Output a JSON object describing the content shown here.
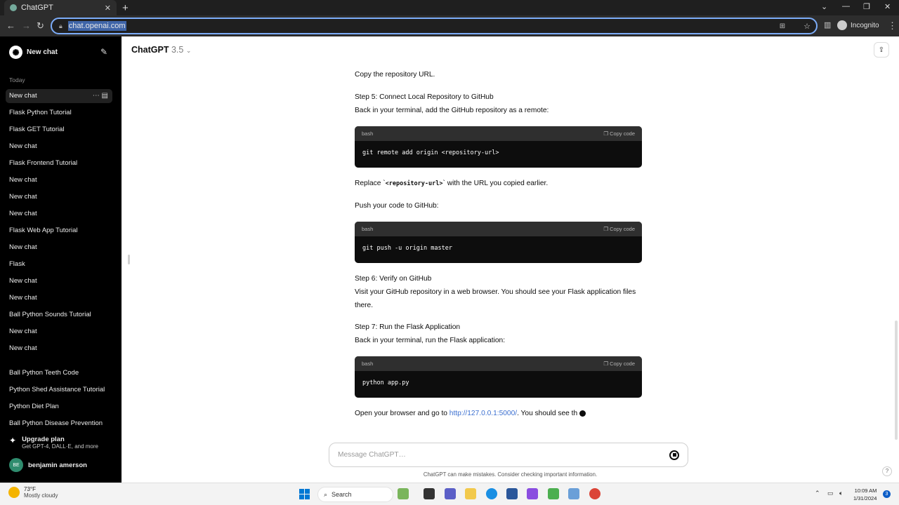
{
  "browser": {
    "tab_title": "ChatGPT",
    "url": "chat.openai.com",
    "incognito_label": "Incognito"
  },
  "sidebar": {
    "new_chat": "New chat",
    "section_today": "Today",
    "items": [
      {
        "label": "New chat",
        "active": true
      },
      {
        "label": "Flask Python Tutorial"
      },
      {
        "label": "Flask GET Tutorial"
      },
      {
        "label": "New chat"
      },
      {
        "label": "Flask Frontend Tutorial"
      },
      {
        "label": "New chat"
      },
      {
        "label": "New chat"
      },
      {
        "label": "New chat"
      },
      {
        "label": "Flask Web App Tutorial"
      },
      {
        "label": "New chat"
      },
      {
        "label": "Flask"
      },
      {
        "label": "New chat"
      },
      {
        "label": "New chat"
      },
      {
        "label": "Ball Python Sounds Tutorial"
      },
      {
        "label": "New chat"
      },
      {
        "label": "New chat"
      }
    ],
    "items2": [
      {
        "label": "Ball Python Teeth Code"
      },
      {
        "label": "Python Shed Assistance Tutorial"
      },
      {
        "label": "Python Diet Plan"
      },
      {
        "label": "Ball Python Disease Prevention"
      }
    ],
    "upgrade_title": "Upgrade plan",
    "upgrade_sub": "Get GPT-4, DALL·E, and more",
    "user_initials": "BE",
    "user_name": "benjamin amerson"
  },
  "header": {
    "model": "ChatGPT",
    "version": "3.5"
  },
  "content": {
    "p1": "Copy the repository URL.",
    "step5_title": "Step 5: Connect Local Repository to GitHub",
    "step5_text": "Back in your terminal, add the GitHub repository as a remote:",
    "code1_lang": "bash",
    "code1": "git remote add origin <repository-url>",
    "replace_pre": "Replace `",
    "replace_code": "<repository-url>",
    "replace_post": "` with the URL you copied earlier.",
    "push_text": "Push your code to GitHub:",
    "code2_lang": "bash",
    "code2": "git push -u origin master",
    "step6_title": "Step 6: Verify on GitHub",
    "step6_text": "Visit your GitHub repository in a web browser. You should see your Flask application files there.",
    "step7_title": "Step 7: Run the Flask Application",
    "step7_text": "Back in your terminal, run the Flask application:",
    "code3_lang": "bash",
    "code3": "python app.py",
    "open_pre": "Open your browser and go to ",
    "open_link": "http://127.0.0.1:5000/",
    "open_post": ". You should see th",
    "copy_label": "Copy code"
  },
  "composer": {
    "placeholder": "Message ChatGPT…",
    "disclaimer": "ChatGPT can make mistakes. Consider checking important information."
  },
  "taskbar": {
    "temp": "73°F",
    "weather": "Mostly cloudy",
    "search": "Search",
    "time": "10:09 AM",
    "date": "1/31/2024",
    "notif_count": "3"
  }
}
